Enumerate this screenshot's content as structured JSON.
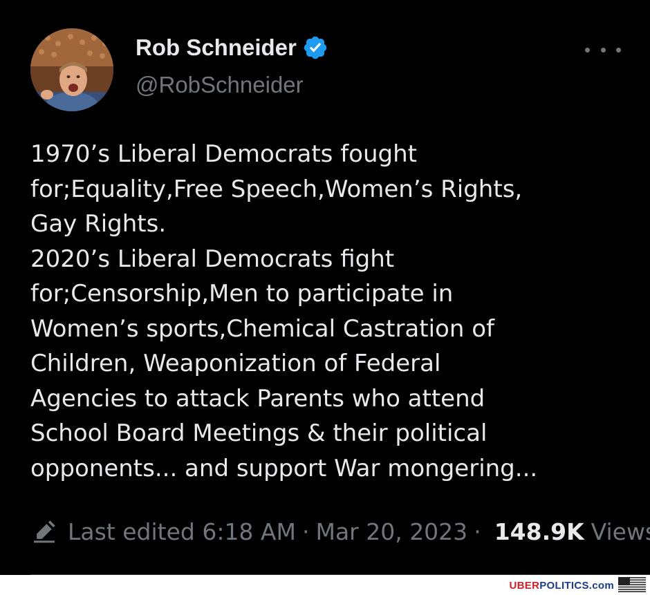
{
  "tweet": {
    "display_name": "Rob Schneider",
    "handle": "@RobSchneider",
    "text_lines": [
      "1970’s Liberal Democrats fought",
      "for;Equality,Free Speech,Women’s Rights,",
      "Gay Rights.",
      "2020’s Liberal Democrats fight",
      "for;Censorship,Men to participate in",
      "Women’s sports,Chemical Castration of",
      "Children, Weaponization of Federal",
      "Agencies to attack Parents who attend",
      "School Board Meetings & their political",
      "opponents... and support War mongering..."
    ],
    "edited_label": "Last edited 6:18 AM",
    "separator": "·",
    "date": "Mar 20, 2023",
    "views_count": "148.9K",
    "views_label": "Views"
  },
  "icons": {
    "verified": "verified-badge-icon",
    "more": "more-options-icon",
    "edit": "pencil-icon",
    "flag": "us-flag-icon"
  },
  "colors": {
    "background": "#000000",
    "primary_text": "#e7e9ea",
    "secondary_text": "#71767b",
    "verified_blue": "#1d9bf0"
  },
  "watermark": {
    "part1": "UBER",
    "part2": "POLITICS",
    "part3": ".com"
  }
}
